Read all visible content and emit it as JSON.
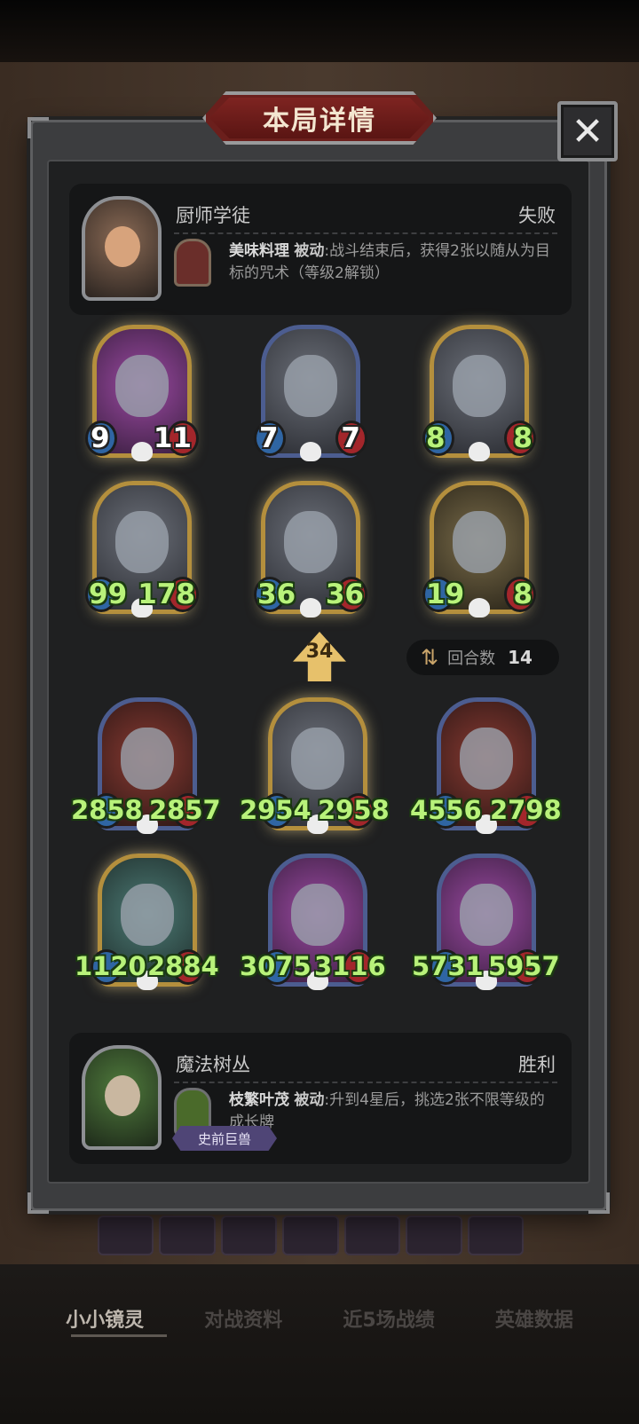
{
  "title": "本局详情",
  "close_label": "✕",
  "top_player": {
    "hero_name": "厨师学徒",
    "result": "失败",
    "skill_name": "美味料理",
    "skill_type": "被动",
    "skill_desc": ":战斗结束后，获得2张以随从为目标的咒术（等级2解锁）"
  },
  "top_board": [
    {
      "attack": "9",
      "health": "11"
    },
    {
      "attack": "7",
      "health": "7"
    },
    {
      "attack": "8",
      "health": "8"
    },
    {
      "attack": "99",
      "health": "178"
    },
    {
      "attack": "36",
      "health": "36"
    },
    {
      "attack": "19",
      "health": "8"
    }
  ],
  "tier": "34",
  "round": {
    "label": "回合数",
    "value": "14"
  },
  "bottom_board": [
    {
      "attack": "2858",
      "health": "2857"
    },
    {
      "attack": "2954",
      "health": "2958"
    },
    {
      "attack": "4556",
      "health": "2798"
    },
    {
      "attack": "1120",
      "health": "2884"
    },
    {
      "attack": "3075",
      "health": "3116"
    },
    {
      "attack": "5731",
      "health": "5957"
    }
  ],
  "bottom_player": {
    "hero_name": "魔法树丛",
    "result": "胜利",
    "skill_name": "枝繁叶茂",
    "skill_type": "被动",
    "skill_desc": ":升到4星后，挑选2张不限等级的成长牌",
    "tag": "史前巨兽"
  },
  "tabs": [
    "小小镜灵",
    "对战资料",
    "近5场战绩",
    "英雄数据"
  ]
}
